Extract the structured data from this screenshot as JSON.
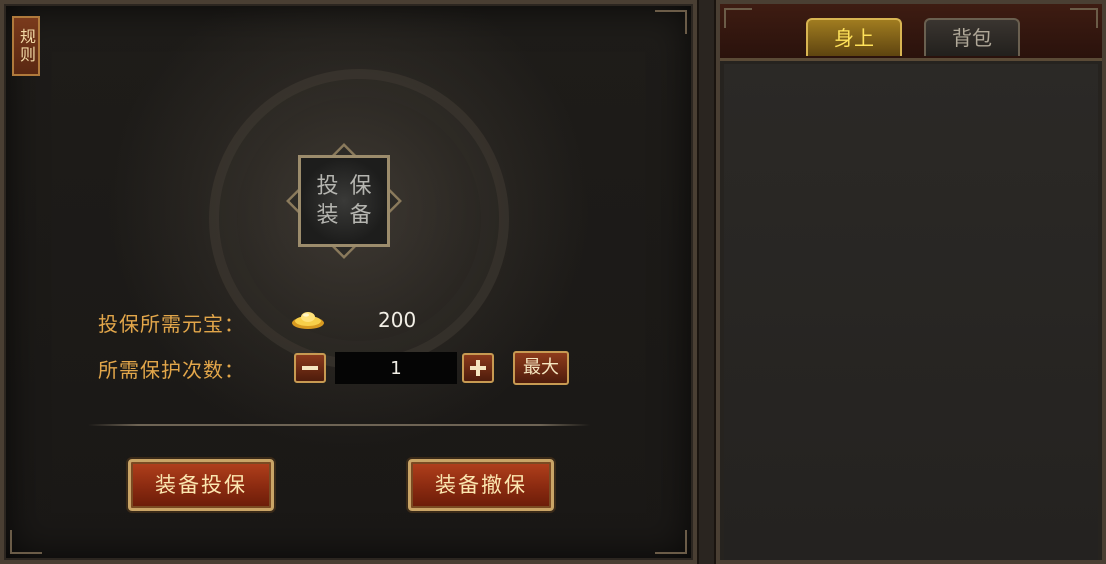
{
  "rules_tab": {
    "label": "规则"
  },
  "slot": {
    "chars": [
      "投",
      "保",
      "装",
      "备"
    ]
  },
  "cost": {
    "label": "投保所需元宝：",
    "currency_icon": "gold-ingot-icon",
    "value": "200"
  },
  "times": {
    "label": "所需保护次数：",
    "minus_icon": "minus-icon",
    "plus_icon": "plus-icon",
    "value": "1",
    "max_label": "最大"
  },
  "actions": {
    "insure_label": "装备投保",
    "uninsure_label": "装备撤保"
  },
  "right_tabs": [
    {
      "label": "身上",
      "active": true
    },
    {
      "label": "背包",
      "active": false
    }
  ],
  "colors": {
    "label_orange": "#e2a64a",
    "tab_active_text": "#ffe25a",
    "button_red": "#8a2a10"
  }
}
